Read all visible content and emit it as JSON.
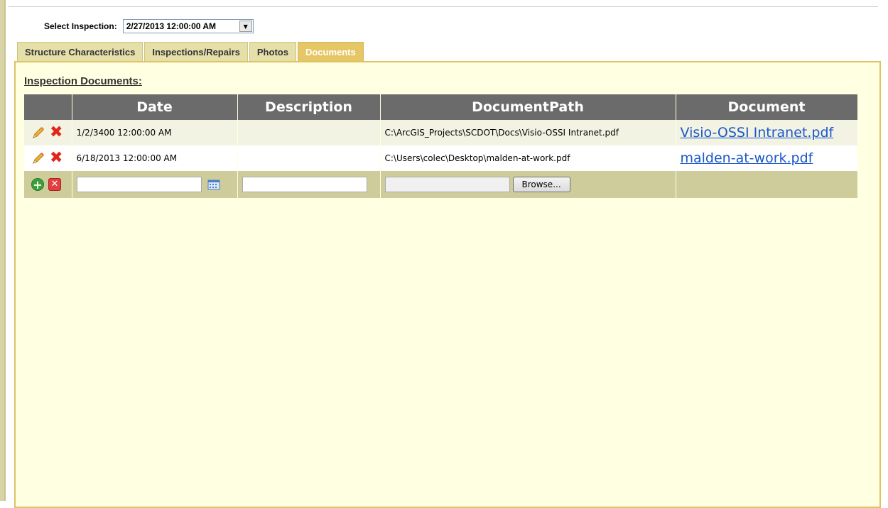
{
  "select_inspection": {
    "label": "Select Inspection:",
    "value": "2/27/2013 12:00:00 AM"
  },
  "tabs": [
    {
      "label": "Structure Characteristics",
      "active": false
    },
    {
      "label": "Inspections/Repairs",
      "active": false
    },
    {
      "label": "Photos",
      "active": false
    },
    {
      "label": "Documents",
      "active": true
    }
  ],
  "section_title": "Inspection Documents:",
  "grid": {
    "columns": [
      "",
      "Date",
      "Description",
      "DocumentPath",
      "Document"
    ],
    "rows": [
      {
        "date": "1/2/3400 12:00:00 AM",
        "description": "",
        "path": "C:\\ArcGIS_Projects\\SCDOT\\Docs\\Visio-OSSI Intranet.pdf",
        "document": "Visio-OSSI Intranet.pdf"
      },
      {
        "date": "6/18/2013 12:00:00 AM",
        "description": "",
        "path": "C:\\Users\\colec\\Desktop\\malden-at-work.pdf",
        "document": "malden-at-work.pdf"
      }
    ],
    "add_row": {
      "browse_label": "Browse..."
    }
  },
  "icons": {
    "edit": "pencil-icon",
    "delete": "red-x-icon",
    "add": "green-plus-icon",
    "cancel": "red-cancel-icon",
    "calendar": "calendar-icon"
  },
  "colors": {
    "panel_bg": "#ffffe1",
    "panel_border": "#e0c262",
    "tab_bg": "#e5dfaa",
    "tab_active_bg": "#e6c766",
    "header_bg": "#6b6b6b",
    "link": "#1a57c9"
  }
}
